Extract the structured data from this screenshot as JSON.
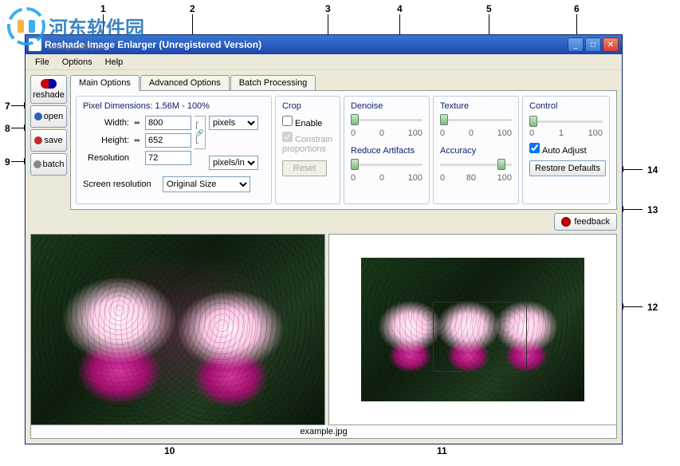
{
  "watermark": {
    "text": "河东软件园",
    "sub": "www.pc0359.cn"
  },
  "callouts": [
    "1",
    "2",
    "3",
    "4",
    "5",
    "6",
    "7",
    "8",
    "9",
    "10",
    "11",
    "12",
    "13",
    "14"
  ],
  "window": {
    "title": "Reshade Image Enlarger (Unregistered Version)",
    "menus": [
      "File",
      "Options",
      "Help"
    ],
    "side": {
      "reshade": "reshade",
      "open": "open",
      "save": "save",
      "batch": "batch"
    },
    "tabs": [
      "Main Options",
      "Advanced Options",
      "Batch Processing"
    ],
    "dim": {
      "title": "Pixel Dimensions: 1.56M - 100%",
      "width_label": "Width:",
      "height_label": "Height:",
      "res_label": "Resolution",
      "width": "800",
      "height": "652",
      "res": "72",
      "unit1": "pixels",
      "unit2": "pixels/inch",
      "screen_label": "Screen resolution",
      "screen_value": "Original Size"
    },
    "crop": {
      "title": "Crop",
      "enable": "Enable",
      "constrain": "Constrain proportions",
      "reset": "Reset"
    },
    "denoise": {
      "title": "Denoise",
      "min": "0",
      "val": "0",
      "max": "100"
    },
    "reduce": {
      "title": "Reduce Artifacts",
      "min": "0",
      "val": "0",
      "max": "100"
    },
    "texture": {
      "title": "Texture",
      "min": "0",
      "val": "0",
      "max": "100"
    },
    "accuracy": {
      "title": "Accuracy",
      "min": "0",
      "val": "80",
      "max": "100"
    },
    "control": {
      "title": "Control",
      "min": "0",
      "val": "1",
      "max": "100",
      "auto": "Auto Adjust",
      "restore": "Restore Defaults"
    },
    "feedback": "feedback",
    "filename": "example.jpg"
  }
}
